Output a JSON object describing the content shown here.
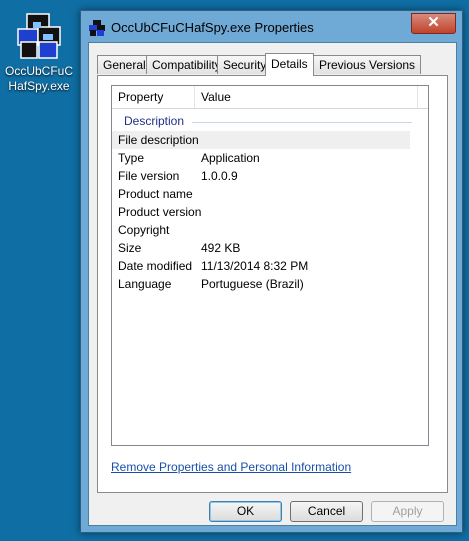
{
  "desktop": {
    "icon_label": "OccUbCFuCHafSpy.exe"
  },
  "window": {
    "title": "OccUbCFuCHafSpy.exe Properties",
    "close_symbol": "✕"
  },
  "tabs": [
    {
      "label": "General",
      "active": false
    },
    {
      "label": "Compatibility",
      "active": false
    },
    {
      "label": "Security",
      "active": false
    },
    {
      "label": "Details",
      "active": true
    },
    {
      "label": "Previous Versions",
      "active": false
    }
  ],
  "details": {
    "columns": {
      "property": "Property",
      "value": "Value"
    },
    "group": "Description",
    "rows": [
      {
        "property": "File description",
        "value": ""
      },
      {
        "property": "Type",
        "value": "Application"
      },
      {
        "property": "File version",
        "value": "1.0.0.9"
      },
      {
        "property": "Product name",
        "value": ""
      },
      {
        "property": "Product version",
        "value": ""
      },
      {
        "property": "Copyright",
        "value": ""
      },
      {
        "property": "Size",
        "value": "492 KB"
      },
      {
        "property": "Date modified",
        "value": "11/13/2014 8:32 PM"
      },
      {
        "property": "Language",
        "value": "Portuguese (Brazil)"
      }
    ]
  },
  "link": "Remove Properties and Personal Information",
  "buttons": {
    "ok": "OK",
    "cancel": "Cancel",
    "apply": "Apply"
  },
  "colors": {
    "desktop": "#0f6fa5",
    "titlebar": "#6fa9d6",
    "close": "#c1432b",
    "link": "#1a4fa8"
  }
}
